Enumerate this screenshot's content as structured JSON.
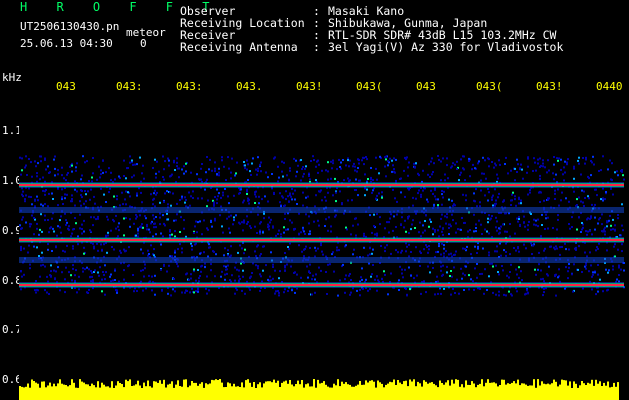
{
  "header": {
    "title": "H R O F F T",
    "file_name": "UT2506130430.pn",
    "meteor_tag": "meteor",
    "date_time": "25.06.13 04:30",
    "count": "0",
    "info": [
      {
        "key": "Observer",
        "value": "Masaki Kano"
      },
      {
        "key": "Receiving Location",
        "value": "Shibukawa, Gunma, Japan"
      },
      {
        "key": "Receiver",
        "value": "RTL-SDR SDR# 43dB L15 103.2MHz CW"
      },
      {
        "key": "Receiving Antenna",
        "value": "3el Yagi(V) Az 330 for Vladivostok"
      }
    ]
  },
  "axes": {
    "y_unit": "kHz",
    "y_ticks": [
      "1.1",
      "1.0",
      "0.9",
      "0.8",
      "0.7",
      "0.6"
    ],
    "x_ticks": [
      "043",
      "043:",
      "043:",
      "043.",
      "043!",
      "043(",
      "043",
      "043(",
      "043!",
      "0440"
    ]
  },
  "colors": {
    "background": "#000000",
    "title": "#00ff66",
    "text": "#ffffff",
    "time_ticks": "#ffff00",
    "spectrum_low": "#0000aa",
    "spectrum_mid": "#00ff88",
    "spectrum_high": "#ff2244",
    "meteor_bar": "#ffff00"
  },
  "spectrogram": {
    "carrier_lines_khz": [
      0.99,
      0.88,
      0.79
    ]
  }
}
